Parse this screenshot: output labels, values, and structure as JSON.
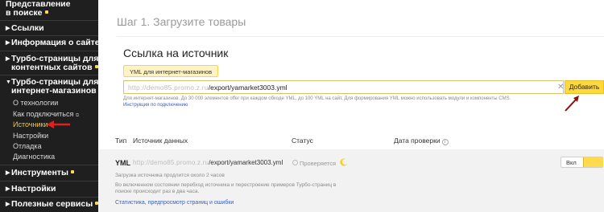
{
  "sidebar": {
    "items": [
      {
        "label_line1": "Представление",
        "label_line2": "в поиске",
        "dot": true
      },
      {
        "label": "Ссылки",
        "dot": false
      },
      {
        "label": "Информация о сайте",
        "dot": true
      },
      {
        "label_line1": "Турбо-страницы для",
        "label_line2": "контентных сайтов",
        "dot": true
      },
      {
        "label_line1": "Турбо-страницы для",
        "label_line2": "интернет-магазинов",
        "dot": false
      },
      {
        "label": "Инструменты",
        "dot": true
      },
      {
        "label": "Настройки",
        "dot": false
      },
      {
        "label": "Полезные сервисы",
        "dot": true
      }
    ],
    "subitems": [
      "О технологии",
      "Как подключиться",
      "Источники",
      "Настройки",
      "Отладка",
      "Диагностика"
    ],
    "active_subitem": "Источники",
    "external_link_glyph": "⧉"
  },
  "step_title": "Шаг 1. Загрузите товары",
  "source_panel": {
    "title": "Ссылка на источник",
    "yml_button": "YML для интернет-магазинов",
    "input": {
      "url_hidden": "http://demo85.promo.z.ru",
      "url_visible": "/export/yamarket3003.yml"
    },
    "add_button": "Добавить",
    "help_text": "Для интернет-магазинов. До 30 000 элементов offer при каждом обходе YML, до 100 YML на сайт. Для формирования YML можно использовать модули и компоненты CMS.",
    "help_link": "Инструкция по подключению"
  },
  "table": {
    "headers": {
      "type": "Тип",
      "source": "Источник данных",
      "status": "Статус",
      "check_date": "Дата проверки"
    },
    "rows": [
      {
        "type": "YML",
        "source_hidden": "http://demo85.promo.z.ru",
        "source_visible": "/export/yamarket3003.yml",
        "status": "Проверяется",
        "toggle_label": "Вкл",
        "note1": "Загрузка источника продлится около 2 часов",
        "note2": "Во включенном состоянии перебход источника и перестроение примеров Турбо-страниц в",
        "note3": "поиске происходит раз в два часа.",
        "link": "Статистика, предпросмотр страниц и ошибки"
      }
    ]
  },
  "colors": {
    "sidebar_bg": "#1f1f1f",
    "accent_yellow": "#ffd83a",
    "active_yellow": "#ffcc00",
    "annotation_red": "#e02020",
    "link_blue": "#3a5fb8",
    "row_bg": "#f2f2f2"
  },
  "icons": [
    "arrow-right-icon",
    "external-link-icon",
    "clear-icon",
    "info-icon",
    "clock-icon",
    "moon-icon",
    "annotation-arrow-icon"
  ]
}
